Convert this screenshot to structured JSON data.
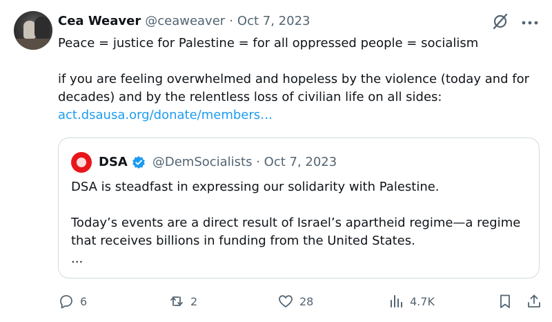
{
  "tweet": {
    "author_name": "Cea Weaver",
    "author_handle": "@ceaweaver",
    "date": "Oct 7, 2023",
    "line1": "Peace = justice for Palestine = for all oppressed people = socialism",
    "line2": "if you are feeling overwhelmed and hopeless by the violence (today and for decades) and by the relentless loss of civilian life on all sides:",
    "link": "act.dsausa.org/donate/members…"
  },
  "quote": {
    "name": "DSA",
    "handle_date": "@DemSocialists · Oct 7, 2023",
    "line1": "DSA is steadfast in expressing our solidarity with Palestine.",
    "line2": "Today’s events are a direct result of Israel’s apartheid regime—a regime that receives billions in funding from the United States.",
    "ellipsis": "..."
  },
  "actions": {
    "replies": "6",
    "reposts": "2",
    "likes": "28",
    "views": "4.7K"
  },
  "icons": {
    "grok": "grok-icon",
    "more": "more-icon",
    "verified": "verified-badge-icon",
    "reply": "reply-icon",
    "repost": "repost-icon",
    "like": "heart-icon",
    "views": "views-icon",
    "bookmark": "bookmark-icon",
    "share": "share-icon"
  },
  "colors": {
    "link": "#1d9bf0",
    "verified": "#1d9bf0",
    "muted": "#536471",
    "dsa_brand": "#e8161b"
  }
}
